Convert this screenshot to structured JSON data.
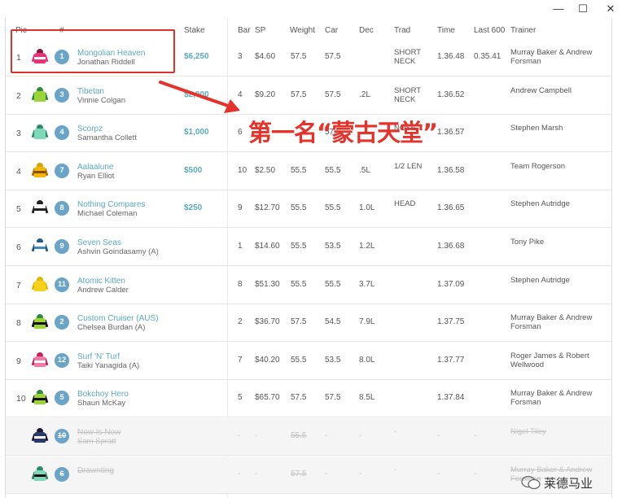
{
  "window": {
    "minimize": "—",
    "maximize": "☐",
    "close": "✕"
  },
  "headers": {
    "pos": "Pic",
    "num": "#",
    "stake": "Stake",
    "bar": "Bar",
    "sp": "SP",
    "weight": "Weight",
    "car": "Car",
    "dec": "Dec",
    "trad": "Trad",
    "time": "Time",
    "last600": "Last 600",
    "trainer": "Trainer"
  },
  "annotation": "第一名“蒙古天堂”",
  "watermark": "莱德马业",
  "rows": [
    {
      "pos": "1",
      "num": "1",
      "horse": "Mongolian Heaven",
      "jockey": "Jonathan Riddell",
      "stake": "$6,250",
      "bar": "3",
      "sp": "$4.60",
      "weight": "57.5",
      "car": "57.5",
      "dec": "",
      "trad": "SHORT NECK",
      "time": "1.36.48",
      "last600": "0.35.41",
      "trainer": "Murray Baker & Andrew Forsman",
      "silk": {
        "cap": "#8a1538",
        "body": "#e8327c",
        "arm": "#e8327c",
        "stripe": "#ffffff"
      }
    },
    {
      "pos": "2",
      "num": "3",
      "horse": "Tibetan",
      "jockey": "Vinnie Colgan",
      "stake": "$2,000",
      "bar": "4",
      "sp": "$9.20",
      "weight": "57.5",
      "car": "57.5",
      "dec": ".2L",
      "trad": "SHORT NECK",
      "time": "1.36.52",
      "last600": "",
      "trainer": "Andrew Campbell",
      "silk": {
        "cap": "#2c8c3c",
        "body": "#9cd338",
        "arm": "#2c8c3c",
        "stripe": "#9cd338"
      }
    },
    {
      "pos": "3",
      "num": "4",
      "horse": "Scorpz",
      "jockey": "Samantha Collett",
      "stake": "$1,000",
      "bar": "6",
      "sp": "",
      "weight": "",
      "car": "57.5",
      "dec": "",
      "trad": "NOSE",
      "time": "1.36.57",
      "last600": "",
      "trainer": "Stephen Marsh",
      "silk": {
        "cap": "#2a8a6a",
        "body": "#7fd8b8",
        "arm": "#2a8a6a",
        "stripe": "#7fd8b8"
      }
    },
    {
      "pos": "4",
      "num": "7",
      "horse": "Aalaalune",
      "jockey": "Ryan Elliot",
      "stake": "$500",
      "bar": "10",
      "sp": "$2.50",
      "weight": "55.5",
      "car": "55.5",
      "dec": ".5L",
      "trad": "1/2 LEN",
      "time": "1.36.58",
      "last600": "",
      "trainer": "Team Rogerson",
      "silk": {
        "cap": "#d9a200",
        "body": "#f2b800",
        "arm": "#b26a00",
        "stripe": "#8a4a00"
      }
    },
    {
      "pos": "5",
      "num": "8",
      "horse": "Nothing Compares",
      "jockey": "Michael Coleman",
      "stake": "$250",
      "bar": "9",
      "sp": "$12.70",
      "weight": "55.5",
      "car": "55.5",
      "dec": "1.0L",
      "trad": "HEAD",
      "time": "1.36.65",
      "last600": "",
      "trainer": "Stephen Autridge",
      "silk": {
        "cap": "#222222",
        "body": "#ffffff",
        "arm": "#222222",
        "stripe": "#222222"
      }
    },
    {
      "pos": "6",
      "num": "9",
      "horse": "Seven Seas",
      "jockey": "Ashvin Goindasamy (A)",
      "stake": "",
      "bar": "1",
      "sp": "$14.60",
      "weight": "55.5",
      "car": "53.5",
      "dec": "1.2L",
      "trad": "",
      "time": "1.36.68",
      "last600": "",
      "trainer": "Tony Pike",
      "silk": {
        "cap": "#1f5a8a",
        "body": "#ffffff",
        "arm": "#1f5a8a",
        "stripe": "#3a8ac8"
      }
    },
    {
      "pos": "7",
      "num": "11",
      "horse": "Atomic Kitten",
      "jockey": "Andrew Calder",
      "stake": "",
      "bar": "8",
      "sp": "$51.30",
      "weight": "55.5",
      "car": "55.5",
      "dec": "3.7L",
      "trad": "",
      "time": "1.37.09",
      "last600": "",
      "trainer": "Stephen Autridge",
      "silk": {
        "cap": "#e0b800",
        "body": "#f7d21c",
        "arm": "#e0b800",
        "stripe": "#f7d21c"
      }
    },
    {
      "pos": "8",
      "num": "2",
      "horse": "Custom Cruiser (AUS)",
      "jockey": "Chelsea Burdan (A)",
      "stake": "",
      "bar": "2",
      "sp": "$36.70",
      "weight": "57.5",
      "car": "54.5",
      "dec": "7.9L",
      "trad": "",
      "time": "1.37.75",
      "last600": "",
      "trainer": "Murray Baker & Andrew Forsman",
      "silk": {
        "cap": "#2c8c3c",
        "body": "#9cd338",
        "arm": "#111111",
        "stripe": "#111111"
      }
    },
    {
      "pos": "9",
      "num": "12",
      "horse": "Surf 'N' Turf",
      "jockey": "Taiki Yanagida (A)",
      "stake": "",
      "bar": "7",
      "sp": "$40.20",
      "weight": "55.5",
      "car": "53.5",
      "dec": "8.0L",
      "trad": "",
      "time": "1.37.77",
      "last600": "",
      "trainer": "Roger James & Robert Wellwood",
      "silk": {
        "cap": "#c3225a",
        "body": "#f07aa8",
        "arm": "#c3225a",
        "stripe": "#ffffff"
      }
    },
    {
      "pos": "10",
      "num": "5",
      "horse": "Bokchoy Hero",
      "jockey": "Shaun McKay",
      "stake": "",
      "bar": "5",
      "sp": "$65.70",
      "weight": "57.5",
      "car": "57.5",
      "dec": "8.5L",
      "trad": "",
      "time": "1.37.84",
      "last600": "",
      "trainer": "Murray Baker & Andrew Forsman",
      "silk": {
        "cap": "#2c8c3c",
        "body": "#9cd338",
        "arm": "#111111",
        "stripe": "#111111"
      }
    }
  ],
  "scratched": [
    {
      "num": "10",
      "horse": "Now Is Now",
      "jockey": "Sam Spratt",
      "bar": "-",
      "sp": "-",
      "weight": "55.5",
      "car": "-",
      "dec": "-",
      "trad": "-",
      "time": "-",
      "last600": "-",
      "trainer": "Nigel Tiley",
      "silk": {
        "cap": "#1a1a3a",
        "body": "#2a3a6a",
        "arm": "#1a1a3a",
        "stripe": "#ffffff"
      }
    },
    {
      "num": "6",
      "horse": "Drawnting",
      "jockey": "",
      "bar": "-",
      "sp": "-",
      "weight": "57.5",
      "car": "-",
      "dec": "-",
      "trad": "-",
      "time": "-",
      "last600": "-",
      "trainer": "Murray Baker & Andrew Forsman",
      "silk": {
        "cap": "#2a8a6a",
        "body": "#7fd8b8",
        "arm": "#2a8a6a",
        "stripe": "#111111"
      }
    }
  ]
}
